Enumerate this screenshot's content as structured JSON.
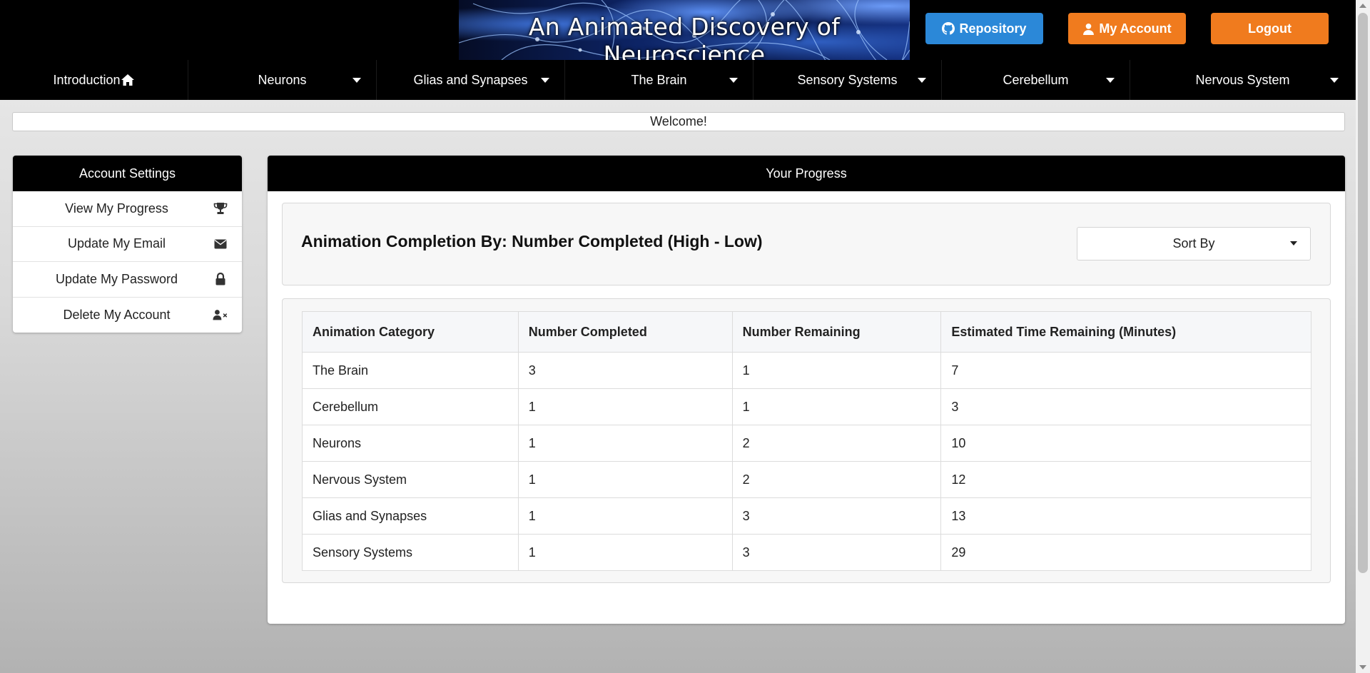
{
  "header": {
    "banner_title": "An Animated Discovery of Neuroscience",
    "buttons": {
      "repository": "Repository",
      "my_account": "My Account",
      "logout": "Logout"
    }
  },
  "nav": {
    "items": [
      {
        "label": "Introduction",
        "icon": "home-icon"
      },
      {
        "label": "Neurons",
        "icon": "caret-down-icon"
      },
      {
        "label": "Glias and Synapses",
        "icon": "caret-down-icon"
      },
      {
        "label": "The Brain",
        "icon": "caret-down-icon"
      },
      {
        "label": "Sensory Systems",
        "icon": "caret-down-icon"
      },
      {
        "label": "Cerebellum",
        "icon": "caret-down-icon"
      },
      {
        "label": "Nervous System",
        "icon": "caret-down-icon"
      }
    ]
  },
  "welcome": "Welcome!",
  "sidebar": {
    "title": "Account Settings",
    "items": [
      {
        "label": "View My Progress",
        "icon": "trophy-icon"
      },
      {
        "label": "Update My Email",
        "icon": "envelope-icon"
      },
      {
        "label": "Update My Password",
        "icon": "lock-icon"
      },
      {
        "label": "Delete My Account",
        "icon": "user-remove-icon"
      }
    ]
  },
  "main": {
    "title": "Your Progress",
    "completion_heading": "Animation Completion By: Number Completed (High - Low)",
    "sort_label": "Sort By",
    "table": {
      "headers": [
        "Animation Category",
        "Number Completed",
        "Number Remaining",
        "Estimated Time Remaining (Minutes)"
      ],
      "rows": [
        [
          "The Brain",
          "3",
          "1",
          "7"
        ],
        [
          "Cerebellum",
          "1",
          "1",
          "3"
        ],
        [
          "Neurons",
          "1",
          "2",
          "10"
        ],
        [
          "Nervous System",
          "1",
          "2",
          "12"
        ],
        [
          "Glias and Synapses",
          "1",
          "3",
          "13"
        ],
        [
          "Sensory Systems",
          "1",
          "3",
          "29"
        ]
      ]
    }
  },
  "colors": {
    "header_bg": "#000000",
    "repo_button": "#2b88d8",
    "account_button": "#f07b1e",
    "logout_button": "#f07b1e"
  }
}
